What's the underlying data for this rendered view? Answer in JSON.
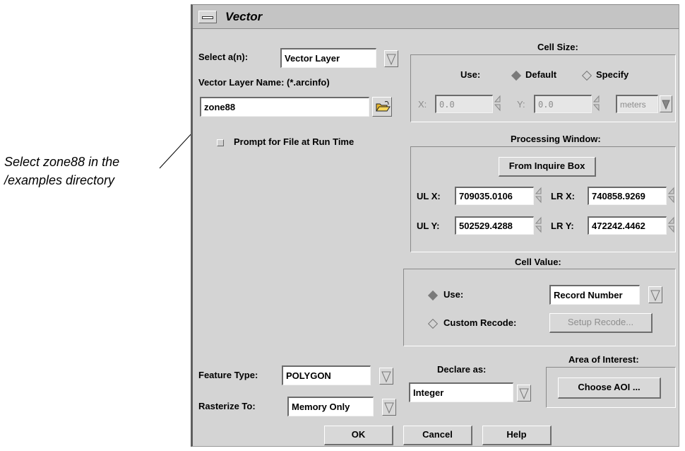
{
  "annotation": {
    "line1": "Select zone88 in the",
    "line2": "/examples directory"
  },
  "window": {
    "title": "Vector"
  },
  "select": {
    "label": "Select a(n):",
    "value": "Vector Layer"
  },
  "vector_layer": {
    "label": "Vector Layer Name: (*.arcinfo)",
    "value": "zone88"
  },
  "prompt_checkbox": {
    "label": "Prompt for File at Run Time",
    "checked": false
  },
  "cell_size": {
    "title": "Cell Size:",
    "use_label": "Use:",
    "default_label": "Default",
    "specify_label": "Specify",
    "selected": "Default",
    "x_label": "X:",
    "x_value": "0.0",
    "y_label": "Y:",
    "y_value": "0.0",
    "units": "meters"
  },
  "processing_window": {
    "title": "Processing Window:",
    "inquire_button": "From Inquire Box",
    "ulx_label": "UL X:",
    "ulx_value": "709035.0106",
    "lrx_label": "LR X:",
    "lrx_value": "740858.9269",
    "uly_label": "UL Y:",
    "uly_value": "502529.4288",
    "lry_label": "LR Y:",
    "lry_value": "472242.4462"
  },
  "cell_value": {
    "title": "Cell Value:",
    "use_label": "Use:",
    "use_value": "Record Number",
    "custom_label": "Custom Recode:",
    "setup_button": "Setup Recode...",
    "selected": "Use"
  },
  "feature_type": {
    "label": "Feature Type:",
    "value": "POLYGON"
  },
  "rasterize_to": {
    "label": "Rasterize To:",
    "value": "Memory Only"
  },
  "declare_as": {
    "label": "Declare as:",
    "value": "Integer"
  },
  "aoi": {
    "title": "Area of Interest:",
    "button": "Choose AOI ..."
  },
  "buttons": {
    "ok": "OK",
    "cancel": "Cancel",
    "help": "Help"
  },
  "colors": {
    "panel": "#d4d4d4",
    "titlebar": "#c4c4c4",
    "radio_selected": "#7a7a7a",
    "radio_unselected": "#c0c0c0"
  }
}
